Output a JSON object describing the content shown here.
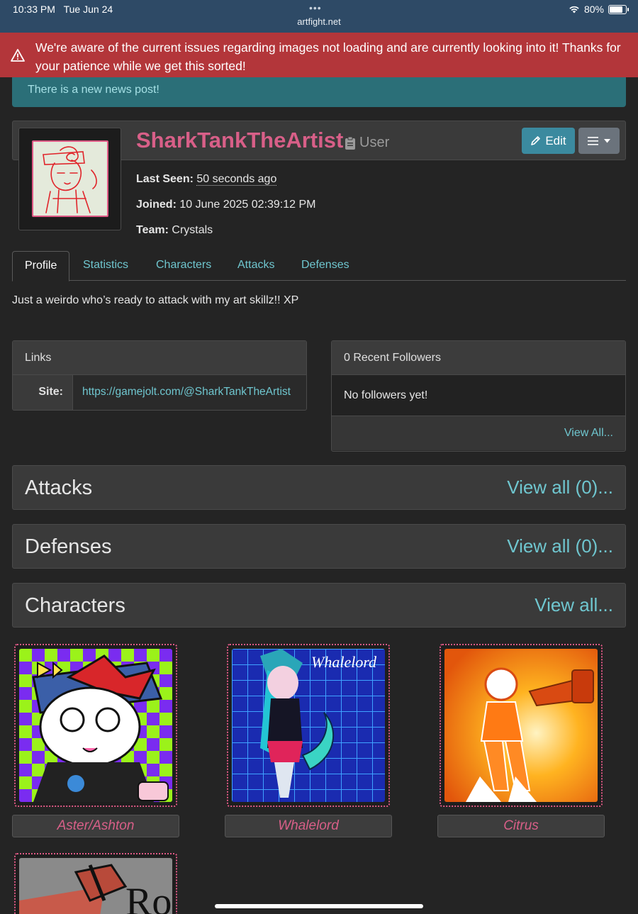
{
  "status": {
    "time": "10:33 PM",
    "date": "Tue Jun 24",
    "url": "artfight.net",
    "battery": "80%",
    "battery_level": 0.8
  },
  "alert": {
    "message": "We're aware of the current issues regarding images not loading and are currently looking into it! Thanks for your patience while we get this sorted!"
  },
  "news": {
    "text": "There is a new news post!"
  },
  "profile": {
    "username": "SharkTankTheArtist",
    "role": "User",
    "edit_label": "Edit",
    "last_seen_label": "Last Seen:",
    "last_seen": "50 seconds ago",
    "joined_label": "Joined:",
    "joined": "10 June 2025 02:39:12 PM",
    "team_label": "Team:",
    "team": "Crystals",
    "bio": "Just a weirdo who’s ready to attack with my art skillz!! XP"
  },
  "tabs": [
    {
      "label": "Profile"
    },
    {
      "label": "Statistics"
    },
    {
      "label": "Characters"
    },
    {
      "label": "Attacks"
    },
    {
      "label": "Defenses"
    }
  ],
  "links": {
    "title": "Links",
    "site_label": "Site:",
    "site_url": "https://gamejolt.com/@SharkTankTheArtist"
  },
  "followers": {
    "title": "0 Recent Followers",
    "empty": "No followers yet!",
    "view_all": "View All..."
  },
  "sections": {
    "attacks": {
      "title": "Attacks",
      "more": "View all (0)..."
    },
    "defenses": {
      "title": "Defenses",
      "more": "View all (0)..."
    },
    "characters": {
      "title": "Characters",
      "more": "View all..."
    }
  },
  "characters": [
    {
      "name": "Aster/Ashton"
    },
    {
      "name": "Whalelord"
    },
    {
      "name": "Citrus"
    }
  ],
  "colors": {
    "accent": "#d85f88",
    "link": "#6fc6cf",
    "alert": "#b3363a",
    "news": "#2b6f78"
  }
}
